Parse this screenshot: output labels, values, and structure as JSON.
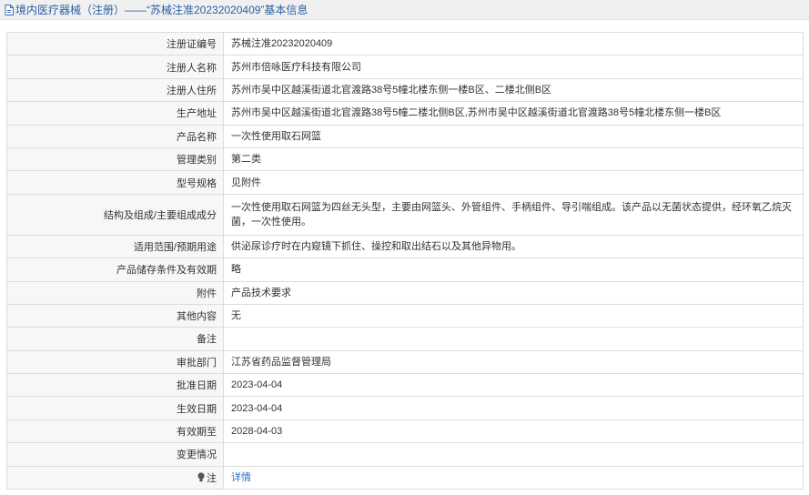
{
  "header": {
    "icon": "document-icon",
    "category": "境内医疗器械（注册）",
    "separator": "——",
    "title": "“苏械注准20232020409”基本信息"
  },
  "rows": [
    {
      "label": "注册证编号",
      "value": "苏械注准20232020409"
    },
    {
      "label": "注册人名称",
      "value": "苏州市倍咏医疗科技有限公司"
    },
    {
      "label": "注册人住所",
      "value": "苏州市吴中区越溪街道北官渡路38号5幢北楼东侧一楼B区、二楼北侧B区"
    },
    {
      "label": "生产地址",
      "value": "苏州市吴中区越溪街道北官渡路38号5幢二楼北侧B区,苏州市吴中区越溪街道北官渡路38号5幢北楼东侧一楼B区"
    },
    {
      "label": "产品名称",
      "value": "一次性使用取石网篮"
    },
    {
      "label": "管理类别",
      "value": "第二类"
    },
    {
      "label": "型号规格",
      "value": "见附件"
    },
    {
      "label": "结构及组成/主要组成成分",
      "value": "一次性使用取石网篮为四丝无头型，主要由网篮头、外管组件、手柄组件、导引喘组成。该产品以无菌状态提供，经环氧乙烷灭菌，一次性使用。"
    },
    {
      "label": "适用范围/预期用途",
      "value": "供泌尿诊疗时在内窥镜下抓住、操控和取出结石以及其他异物用。"
    },
    {
      "label": "产品储存条件及有效期",
      "value": "略"
    },
    {
      "label": "附件",
      "value": "产品技术要求"
    },
    {
      "label": "其他内容",
      "value": "无"
    },
    {
      "label": "备注",
      "value": ""
    },
    {
      "label": "审批部门",
      "value": "江苏省药品监督管理局"
    },
    {
      "label": "批准日期",
      "value": "2023-04-04"
    },
    {
      "label": "生效日期",
      "value": "2023-04-04"
    },
    {
      "label": "有效期至",
      "value": "2028-04-03"
    },
    {
      "label": "变更情况",
      "value": ""
    }
  ],
  "note_row": {
    "icon": "lightbulb-icon",
    "label": "注",
    "link": "详情"
  },
  "colors": {
    "link": "#2b6fc2",
    "header_text": "#2c5ea6",
    "label_bg": "#f7f7f7",
    "border": "#dcdcdc",
    "text": "#333333",
    "header_bg": "#f0f0f0"
  }
}
